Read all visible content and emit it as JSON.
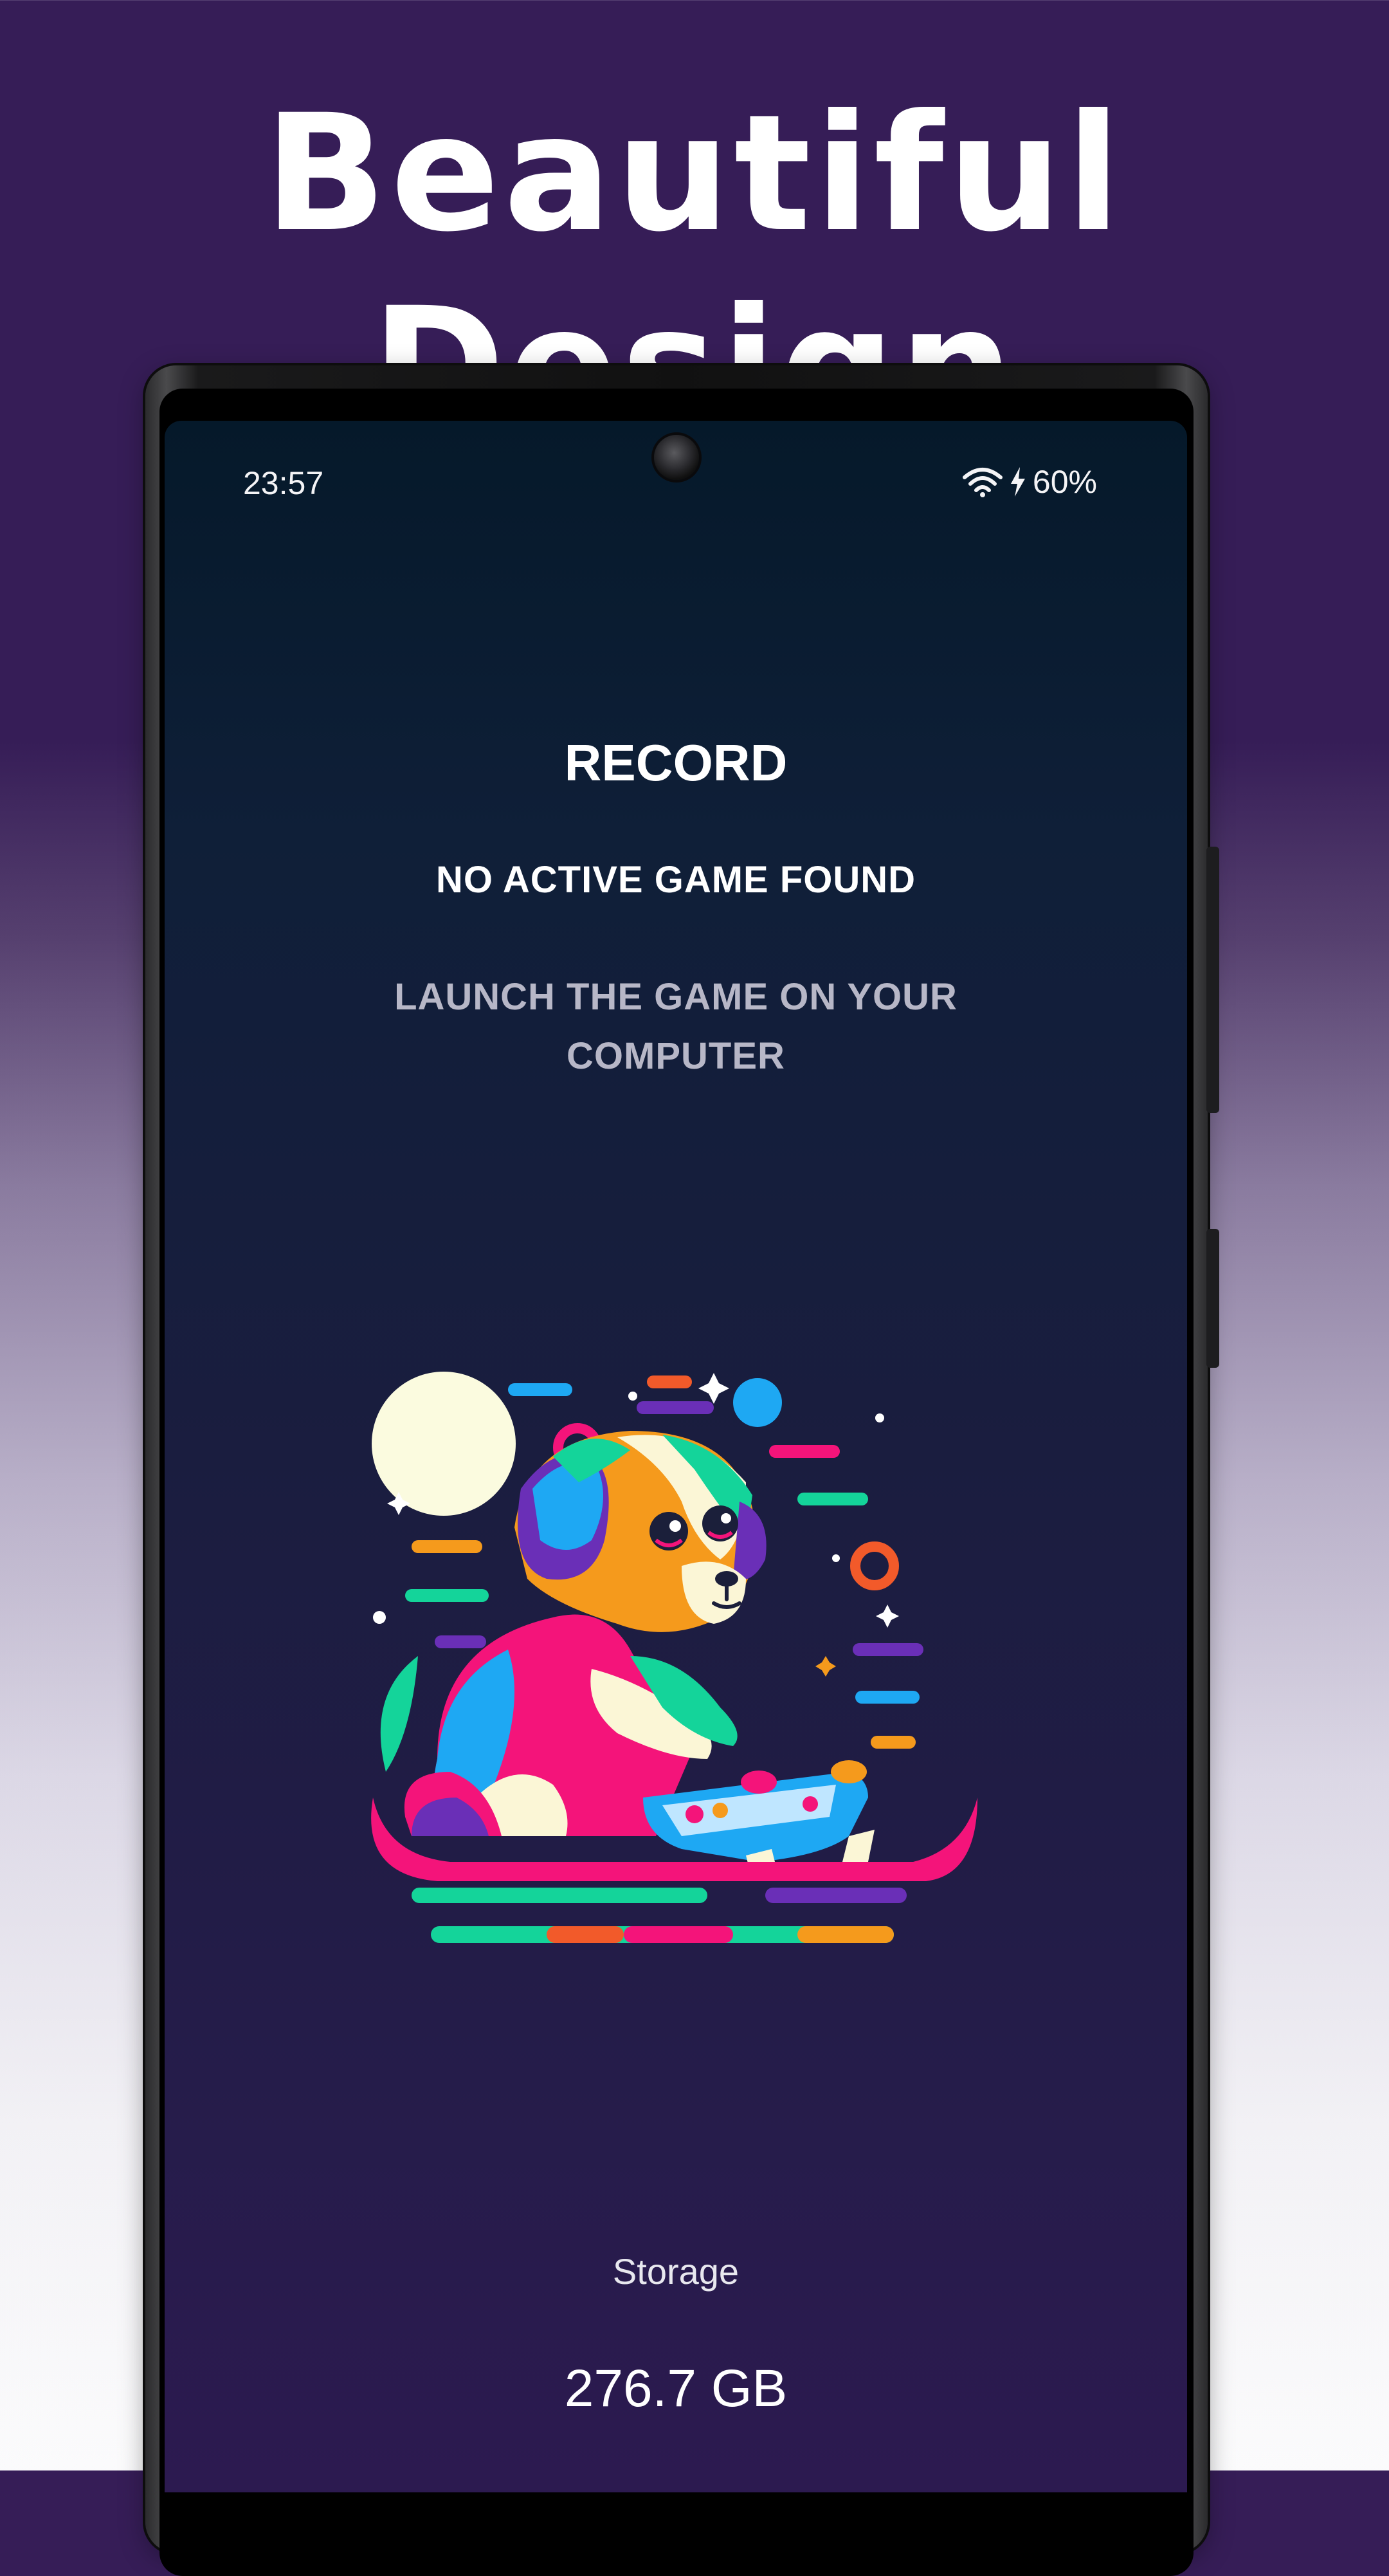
{
  "promo": {
    "headline": "Beautiful Design"
  },
  "status_bar": {
    "time": "23:57",
    "battery": "60%",
    "icons": [
      "wifi-icon",
      "charging-bolt-icon"
    ]
  },
  "screen": {
    "title": "RECORD",
    "subtitle": "NO ACTIVE GAME FOUND",
    "hint": "LAUNCH THE GAME ON YOUR COMPUTER",
    "illustration": "dog-playing-game-controller-illustration"
  },
  "storage": {
    "label": "Storage",
    "value": "276.7 GB"
  },
  "colors": {
    "background_top": "#361d57",
    "background_bottom": "#fbfbfc",
    "screen_top": "#05192a",
    "screen_bottom": "#2c1a50",
    "text_primary": "#ffffff",
    "text_muted": "#b7b7c7"
  }
}
